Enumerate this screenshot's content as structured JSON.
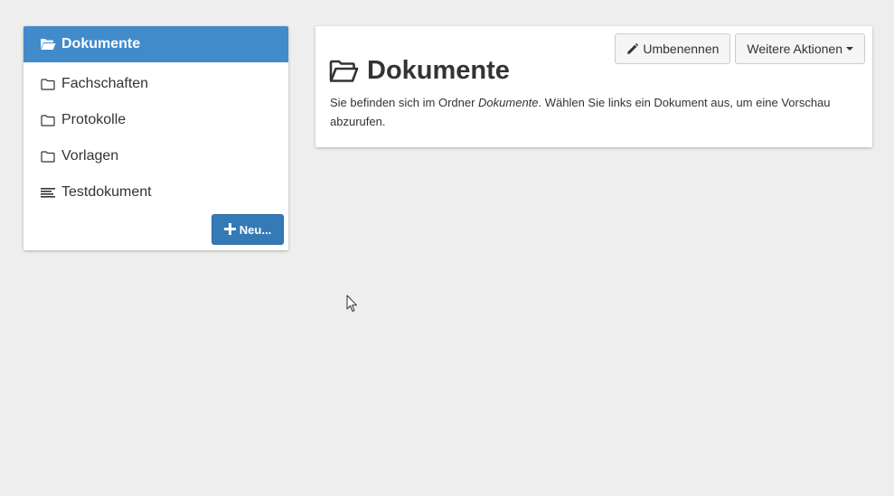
{
  "sidebar": {
    "header": {
      "icon": "folder-open-icon",
      "title": "Dokumente"
    },
    "items": [
      {
        "icon": "folder-icon",
        "label": "Fachschaften"
      },
      {
        "icon": "folder-icon",
        "label": "Protokolle"
      },
      {
        "icon": "folder-icon",
        "label": "Vorlagen"
      },
      {
        "icon": "document-lines-icon",
        "label": "Testdokument"
      }
    ],
    "new_button": {
      "icon": "plus-icon",
      "label": "Neu..."
    }
  },
  "main": {
    "title": "Dokumente",
    "title_icon": "folder-open-icon",
    "toolbar": {
      "rename_label": "Umbenennen",
      "rename_icon": "pencil-icon",
      "more_label": "Weitere Aktionen",
      "more_icon": "caret-down-icon"
    },
    "description": {
      "before": "Sie befinden sich im Ordner ",
      "folder": "Dokumente",
      "after": ". Wählen Sie links ein Dokument aus, um eine Vorschau abzurufen."
    }
  },
  "colors": {
    "background": "#eeeeee",
    "header_blue": "#428bca",
    "button_blue": "#337ab7"
  }
}
